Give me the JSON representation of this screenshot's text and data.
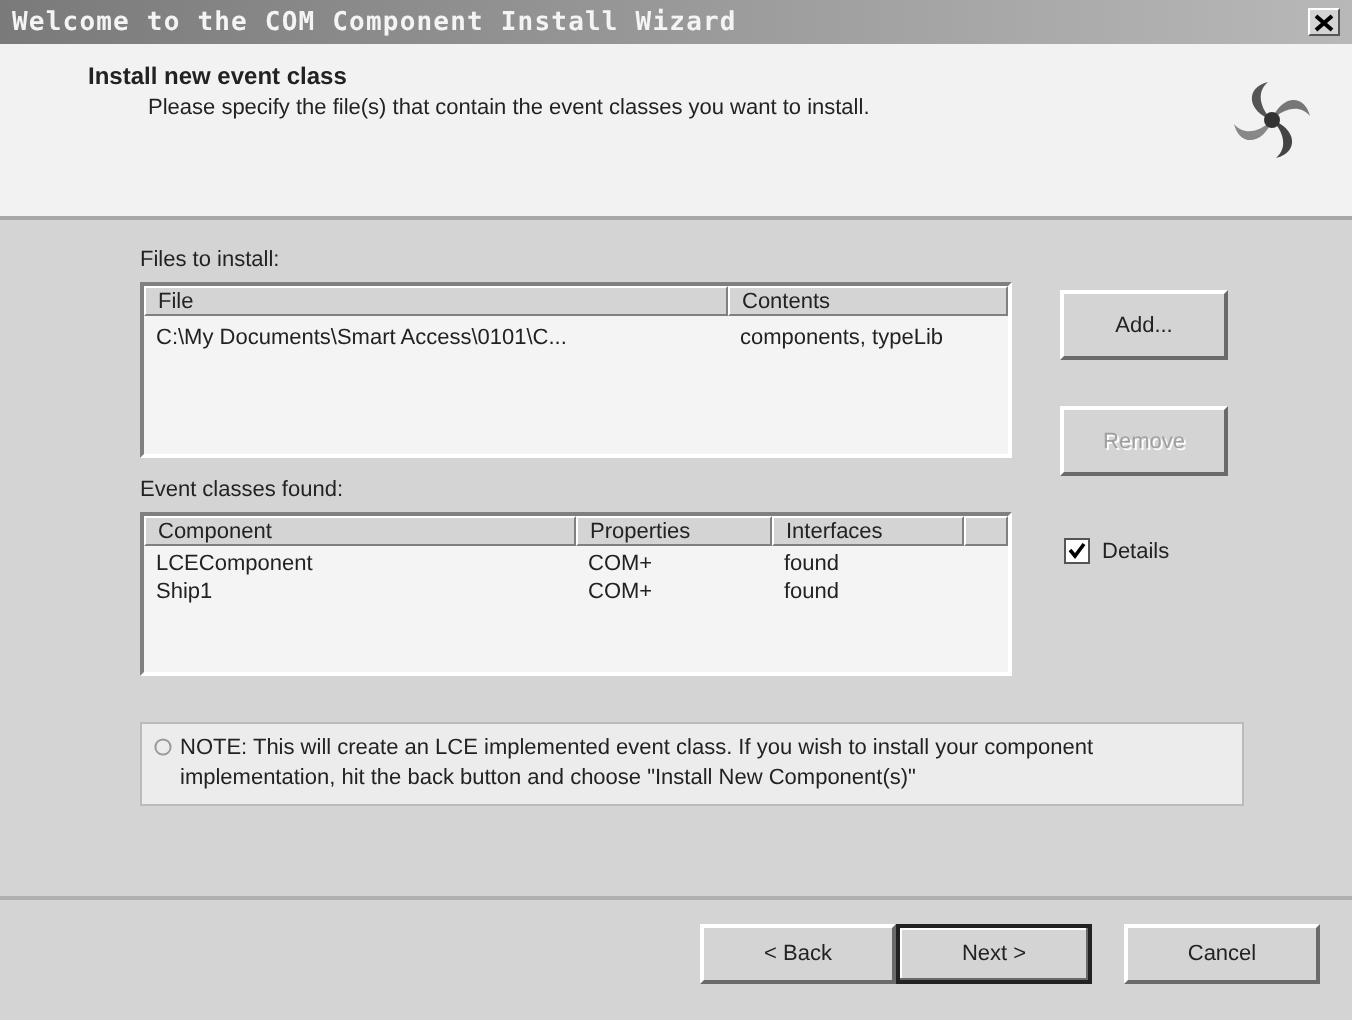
{
  "window": {
    "title": "Welcome to the COM Component Install Wizard"
  },
  "header": {
    "title": "Install new event class",
    "subtitle": "Please specify the file(s) that contain the event classes you want to install."
  },
  "files": {
    "label": "Files to install:",
    "columns": [
      "File",
      "Contents"
    ],
    "rows": [
      [
        "C:\\My Documents\\Smart Access\\0101\\C...",
        "components, typeLib"
      ]
    ]
  },
  "file_buttons": [
    {
      "label": "Add...",
      "disabled": false
    },
    {
      "label": "Remove",
      "disabled": true
    }
  ],
  "events": {
    "label": "Event classes found:",
    "columns": [
      "Component",
      "Properties",
      "Interfaces"
    ],
    "rows": [
      [
        "LCEComponent",
        "COM+",
        "found"
      ],
      [
        "Ship1",
        "COM+",
        "found"
      ]
    ]
  },
  "details": {
    "label": "Details",
    "checked": true
  },
  "note": "NOTE: This will create an LCE implemented event class.  If you wish to install your component implementation, hit the back button and choose \"Install New Component(s)\"",
  "nav_buttons": [
    {
      "label": "< Back",
      "default": false
    },
    {
      "label": "Next >",
      "default": true
    },
    {
      "label": "Cancel",
      "default": false
    }
  ]
}
